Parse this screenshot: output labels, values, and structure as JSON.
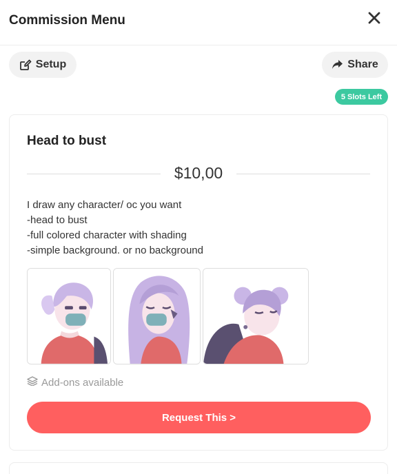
{
  "header": {
    "title": "Commission Menu",
    "close_icon": "close-icon"
  },
  "toolbar": {
    "setup_label": "Setup",
    "setup_icon": "edit-icon",
    "share_label": "Share",
    "share_icon": "share-arrow-icon"
  },
  "slots_badge": {
    "label": "5 Slots Left",
    "color": "#3cc9a0"
  },
  "commission": {
    "title": "Head to bust",
    "price": "$10,00",
    "description": [
      "I draw any character/ oc you want",
      "-head to bust",
      "-full colored character with shading",
      "-simple background. or no background"
    ],
    "addons_label": "Add-ons available",
    "addons_icon": "layers-icon",
    "request_label": "Request This >",
    "request_color": "#ff5f5f"
  }
}
